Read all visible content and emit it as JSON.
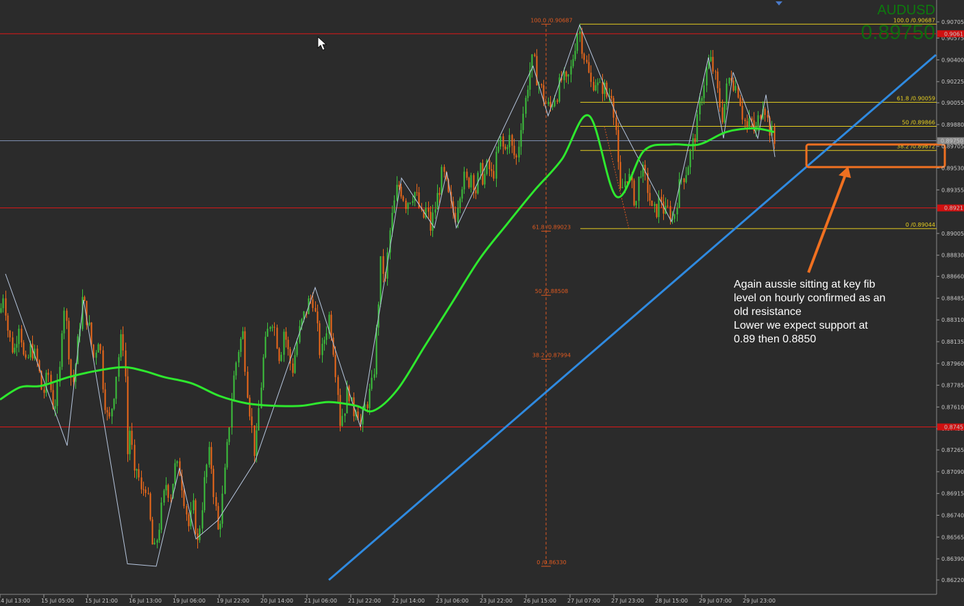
{
  "symbol": "AUDUSD",
  "big_price": "0.89750",
  "annotation": {
    "lines": [
      "Again aussie sitting at key fib",
      "level on hourly confirmed as an",
      "old resistance",
      "Lower we expect support at",
      "0.89 then 0.8850"
    ]
  },
  "colors": {
    "background": "#2b2b2b",
    "bull_candle": "#3cc43c",
    "bear_candle": "#f06a1a",
    "ma_line": "#2ee82e",
    "trendline": "#2f8ae0",
    "horizontal_level": "#e01818",
    "fib_right": "#e8d020",
    "fib_left": "#e05a20",
    "zigzag": "#b8c8e0",
    "annotation_box": "#f07020"
  },
  "chart_data": {
    "type": "candlestick",
    "symbol": "AUDUSD",
    "timeframe": "H1",
    "x_ticks": [
      "14 Jul 13:00",
      "15 Jul 05:00",
      "15 Jul 21:00",
      "16 Jul 13:00",
      "19 Jul 06:00",
      "19 Jul 22:00",
      "20 Jul 14:00",
      "21 Jul 06:00",
      "21 Jul 22:00",
      "22 Jul 14:00",
      "23 Jul 06:00",
      "23 Jul 22:00",
      "26 Jul 15:00",
      "27 Jul 07:00",
      "27 Jul 23:00",
      "28 Jul 15:00",
      "29 Jul 07:00",
      "29 Jul 23:00"
    ],
    "y_ticks": [
      "0.90705",
      "0.90575",
      "0.90400",
      "0.90225",
      "0.90055",
      "0.89880",
      "0.89705",
      "0.89530",
      "0.89355",
      "0.89005",
      "0.88830",
      "0.88660",
      "0.88485",
      "0.88310",
      "0.88135",
      "0.87960",
      "0.87785",
      "0.87610",
      "0.87435",
      "0.87265",
      "0.87090",
      "0.86915",
      "0.86740",
      "0.86565",
      "0.86390",
      "0.86220"
    ],
    "ylim": [
      0.8622,
      0.9085
    ],
    "current_price": 0.8975,
    "price_labels": [
      {
        "value": 0.9061,
        "label": "0.9061",
        "highlight": "red"
      },
      {
        "value": 0.8975,
        "label": "0.89750",
        "highlight": "gray"
      },
      {
        "value": 0.8921,
        "label": "0.8921",
        "highlight": "red"
      },
      {
        "value": 0.8745,
        "label": "0.8745",
        "highlight": "red"
      }
    ],
    "horizontal_levels": [
      0.9061,
      0.8921,
      0.8745
    ],
    "fib_right": [
      {
        "label": "100.0 /0.90687",
        "value": 0.90687
      },
      {
        "label": "61.8 /0.90059",
        "value": 0.90059
      },
      {
        "label": "50 /0.89866",
        "value": 0.89866
      },
      {
        "label": "38.2 /0.89672",
        "value": 0.89672
      },
      {
        "label": "0 /0.89044",
        "value": 0.89044
      }
    ],
    "fib_left": [
      {
        "label": "100.0 /0.90687",
        "value": 0.90687
      },
      {
        "label": "61.8 /0.89023",
        "value": 0.89023
      },
      {
        "label": "50 /0.88508",
        "value": 0.88508
      },
      {
        "label": "38.2 /0.87994",
        "value": 0.87994
      },
      {
        "label": "0 /0.86330",
        "value": 0.8633
      }
    ],
    "price_path": [
      [
        0,
        0.8837
      ],
      [
        5,
        0.8855
      ],
      [
        12,
        0.8818
      ],
      [
        20,
        0.8805
      ],
      [
        28,
        0.8832
      ],
      [
        36,
        0.879
      ],
      [
        45,
        0.881
      ],
      [
        55,
        0.8795
      ],
      [
        62,
        0.877
      ],
      [
        70,
        0.8788
      ],
      [
        78,
        0.876
      ],
      [
        86,
        0.878
      ],
      [
        92,
        0.885
      ],
      [
        98,
        0.882
      ],
      [
        105,
        0.8775
      ],
      [
        112,
        0.8805
      ],
      [
        120,
        0.8848
      ],
      [
        128,
        0.883
      ],
      [
        136,
        0.88
      ],
      [
        144,
        0.882
      ],
      [
        150,
        0.8778
      ],
      [
        158,
        0.8745
      ],
      [
        165,
        0.877
      ],
      [
        172,
        0.88
      ],
      [
        178,
        0.882
      ],
      [
        182,
        0.8795
      ],
      [
        186,
        0.872
      ],
      [
        190,
        0.875
      ],
      [
        195,
        0.87
      ],
      [
        200,
        0.8715
      ],
      [
        205,
        0.869
      ],
      [
        212,
        0.87
      ],
      [
        218,
        0.8672
      ],
      [
        224,
        0.864
      ],
      [
        230,
        0.866
      ],
      [
        236,
        0.868
      ],
      [
        242,
        0.87
      ],
      [
        248,
        0.869
      ],
      [
        255,
        0.8712
      ],
      [
        262,
        0.871
      ],
      [
        268,
        0.869
      ],
      [
        275,
        0.8665
      ],
      [
        282,
        0.868
      ],
      [
        288,
        0.865
      ],
      [
        294,
        0.868
      ],
      [
        300,
        0.871
      ],
      [
        306,
        0.8725
      ],
      [
        312,
        0.869
      ],
      [
        318,
        0.866
      ],
      [
        324,
        0.8685
      ],
      [
        330,
        0.872
      ],
      [
        336,
        0.876
      ],
      [
        342,
        0.879
      ],
      [
        348,
        0.881
      ],
      [
        354,
        0.882
      ],
      [
        360,
        0.878
      ],
      [
        366,
        0.875
      ],
      [
        372,
        0.872
      ],
      [
        378,
        0.8765
      ],
      [
        384,
        0.88
      ],
      [
        390,
        0.882
      ],
      [
        396,
        0.8835
      ],
      [
        402,
        0.882
      ],
      [
        408,
        0.88
      ],
      [
        414,
        0.8825
      ],
      [
        420,
        0.8805
      ],
      [
        426,
        0.879
      ],
      [
        432,
        0.881
      ],
      [
        438,
        0.8825
      ],
      [
        444,
        0.8835
      ],
      [
        450,
        0.8845
      ],
      [
        456,
        0.885
      ],
      [
        462,
        0.8825
      ],
      [
        468,
        0.88
      ],
      [
        474,
        0.882
      ],
      [
        480,
        0.8835
      ],
      [
        486,
        0.881
      ],
      [
        492,
        0.878
      ],
      [
        496,
        0.875
      ],
      [
        502,
        0.876
      ],
      [
        508,
        0.8778
      ],
      [
        514,
        0.8755
      ],
      [
        520,
        0.8765
      ],
      [
        526,
        0.8745
      ],
      [
        532,
        0.876
      ],
      [
        538,
        0.877
      ],
      [
        544,
        0.878
      ],
      [
        550,
        0.883
      ],
      [
        556,
        0.888
      ],
      [
        562,
        0.886
      ],
      [
        568,
        0.89
      ],
      [
        574,
        0.892
      ],
      [
        580,
        0.894
      ],
      [
        586,
        0.8935
      ],
      [
        592,
        0.8925
      ],
      [
        598,
        0.893
      ],
      [
        604,
        0.8935
      ],
      [
        610,
        0.8925
      ],
      [
        616,
        0.891
      ],
      [
        622,
        0.892
      ],
      [
        628,
        0.8905
      ],
      [
        634,
        0.892
      ],
      [
        640,
        0.8935
      ],
      [
        646,
        0.895
      ],
      [
        652,
        0.8935
      ],
      [
        658,
        0.892
      ],
      [
        664,
        0.8915
      ],
      [
        670,
        0.8935
      ],
      [
        676,
        0.8945
      ],
      [
        682,
        0.894
      ],
      [
        688,
        0.895
      ],
      [
        694,
        0.8935
      ],
      [
        700,
        0.895
      ],
      [
        706,
        0.8945
      ],
      [
        712,
        0.8955
      ],
      [
        718,
        0.8945
      ],
      [
        724,
        0.896
      ],
      [
        730,
        0.8975
      ],
      [
        736,
        0.8965
      ],
      [
        742,
        0.898
      ],
      [
        748,
        0.8965
      ],
      [
        754,
        0.896
      ],
      [
        760,
        0.899
      ],
      [
        766,
        0.9005
      ],
      [
        772,
        0.903
      ],
      [
        778,
        0.904
      ],
      [
        784,
        0.9025
      ],
      [
        790,
        0.9015
      ],
      [
        796,
        0.9005
      ],
      [
        802,
        0.9
      ],
      [
        808,
        0.901
      ],
      [
        814,
        0.9015
      ],
      [
        820,
        0.9025
      ],
      [
        826,
        0.902
      ],
      [
        832,
        0.903
      ],
      [
        838,
        0.905
      ],
      [
        844,
        0.9068
      ],
      [
        850,
        0.905
      ],
      [
        856,
        0.9035
      ],
      [
        862,
        0.902
      ],
      [
        868,
        0.9025
      ],
      [
        874,
        0.9015
      ],
      [
        880,
        0.902
      ],
      [
        886,
        0.901
      ],
      [
        892,
        0.9015
      ],
      [
        898,
        0.899
      ],
      [
        904,
        0.893
      ],
      [
        910,
        0.894
      ],
      [
        916,
        0.895
      ],
      [
        922,
        0.8935
      ],
      [
        928,
        0.8925
      ],
      [
        934,
        0.8955
      ],
      [
        940,
        0.8945
      ],
      [
        946,
        0.8935
      ],
      [
        952,
        0.8915
      ],
      [
        958,
        0.892
      ],
      [
        964,
        0.893
      ],
      [
        970,
        0.8915
      ],
      [
        976,
        0.892
      ],
      [
        982,
        0.891
      ],
      [
        988,
        0.893
      ],
      [
        994,
        0.8945
      ],
      [
        1000,
        0.895
      ],
      [
        1006,
        0.896
      ],
      [
        1012,
        0.8975
      ],
      [
        1018,
        0.899
      ],
      [
        1024,
        0.9015
      ],
      [
        1030,
        0.903
      ],
      [
        1036,
        0.904
      ],
      [
        1042,
        0.903
      ],
      [
        1048,
        0.901
      ],
      [
        1054,
        0.8995
      ],
      [
        1060,
        0.9015
      ],
      [
        1066,
        0.903
      ],
      [
        1072,
        0.902
      ],
      [
        1078,
        0.9015
      ],
      [
        1084,
        0.8995
      ],
      [
        1090,
        0.8985
      ],
      [
        1096,
        0.899
      ],
      [
        1102,
        0.898
      ],
      [
        1108,
        0.8995
      ],
      [
        1114,
        0.901
      ],
      [
        1120,
        0.899
      ],
      [
        1126,
        0.898
      ],
      [
        1131,
        0.897
      ]
    ],
    "ma_path": [
      [
        0,
        0.8767
      ],
      [
        30,
        0.8777
      ],
      [
        60,
        0.8778
      ],
      [
        100,
        0.8785
      ],
      [
        140,
        0.879
      ],
      [
        180,
        0.8793
      ],
      [
        210,
        0.879
      ],
      [
        240,
        0.8785
      ],
      [
        280,
        0.878
      ],
      [
        320,
        0.877
      ],
      [
        360,
        0.8764
      ],
      [
        400,
        0.8762
      ],
      [
        440,
        0.8762
      ],
      [
        480,
        0.8765
      ],
      [
        520,
        0.8762
      ],
      [
        545,
        0.8758
      ],
      [
        580,
        0.8775
      ],
      [
        620,
        0.881
      ],
      [
        660,
        0.8845
      ],
      [
        700,
        0.888
      ],
      [
        740,
        0.8908
      ],
      [
        780,
        0.8935
      ],
      [
        820,
        0.896
      ],
      [
        860,
        0.8995
      ],
      [
        900,
        0.893
      ],
      [
        940,
        0.8967
      ],
      [
        980,
        0.8972
      ],
      [
        1020,
        0.8972
      ],
      [
        1060,
        0.8982
      ],
      [
        1100,
        0.8985
      ],
      [
        1130,
        0.8982
      ]
    ],
    "trendline": [
      [
        480,
        0.8622
      ],
      [
        1366,
        0.9044
      ]
    ],
    "zigzag_path": [
      [
        8,
        0.8868
      ],
      [
        98,
        0.873
      ],
      [
        122,
        0.8847
      ],
      [
        186,
        0.8635
      ],
      [
        228,
        0.8633
      ],
      [
        262,
        0.8712
      ],
      [
        286,
        0.8655
      ],
      [
        318,
        0.867
      ],
      [
        372,
        0.8717
      ],
      [
        460,
        0.8857
      ],
      [
        526,
        0.8745
      ],
      [
        586,
        0.8945
      ],
      [
        634,
        0.8905
      ],
      [
        652,
        0.895
      ],
      [
        666,
        0.8905
      ],
      [
        778,
        0.9035
      ],
      [
        800,
        0.8995
      ],
      [
        846,
        0.9068
      ],
      [
        904,
        0.899
      ],
      [
        980,
        0.891
      ],
      [
        1034,
        0.9042
      ],
      [
        1056,
        0.8977
      ],
      [
        1070,
        0.903
      ],
      [
        1106,
        0.8977
      ],
      [
        1118,
        0.9012
      ],
      [
        1131,
        0.8962
      ]
    ]
  }
}
